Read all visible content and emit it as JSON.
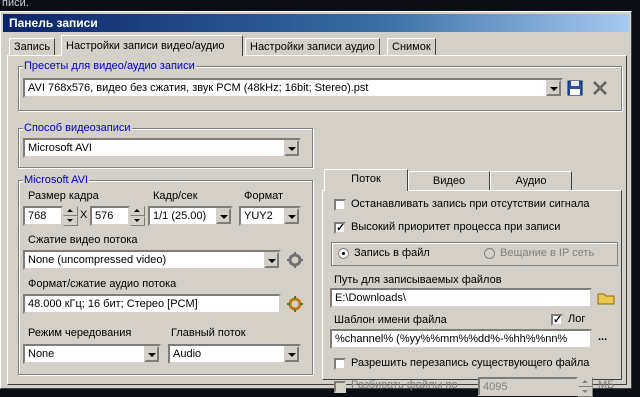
{
  "background_text": "писи.",
  "window": {
    "title": "Панель записи"
  },
  "tabs": [
    {
      "label": "Запись"
    },
    {
      "label": "Настройки записи видео/аудио"
    },
    {
      "label": "Настройки записи аудио"
    },
    {
      "label": "Снимок"
    }
  ],
  "presets": {
    "title": "Пресеты для видео/аудио записи",
    "value": "AVI 768x576, видео без сжатия, звук PCM (48kHz; 16bit; Stereo).pst"
  },
  "video_method": {
    "title": "Способ видеозаписи",
    "value": "Microsoft AVI"
  },
  "msavi": {
    "title": "Microsoft AVI",
    "frame_size_label": "Размер кадра",
    "width": "768",
    "x_label": "X",
    "height": "576",
    "fps_label": "Кадр/сек",
    "fps_value": "1/1 (25.00)",
    "format_label": "Формат",
    "format_value": "YUY2",
    "compression_label": "Сжатие видео потока",
    "compression_value": "None (uncompressed video)",
    "audio_label": "Формат/сжатие аудио потока",
    "audio_value": "48.000 кГц; 16 бит; Стерео [PCM]",
    "interleave_label": "Режим чередования",
    "interleave_value": "None",
    "master_label": "Главный поток",
    "master_value": "Audio"
  },
  "right_tabs": [
    {
      "label": "Поток"
    },
    {
      "label": "Видео"
    },
    {
      "label": "Аудио"
    }
  ],
  "stream": {
    "stop_no_signal": "Останавливать запись при отсутствии сигнала",
    "high_priority": "Высокий приоритет процесса при записи",
    "record_to_file": "Запись в файл",
    "ip_broadcast": "Вещание в IP сеть",
    "path_label": "Путь для записываемых файлов",
    "path_value": "E:\\Downloads\\",
    "template_label": "Шаблон имени файла",
    "log_label": "Лог",
    "template_value": "%channel% (%yy%%mm%%dd%-%hh%%nn%",
    "browse_ellipsis": "...",
    "allow_overwrite": "Разрешить перезапись существующего файла",
    "split_label": "Разбивать файлы по",
    "split_value": "4095",
    "split_unit": "МБ"
  },
  "colors": {
    "title_start": "#0a246a",
    "title_end": "#a6caf0",
    "group_title": "#0000c8",
    "face": "#d4d0c8"
  },
  "icons": [
    "save-icon",
    "delete-icon",
    "settings-icon",
    "audio-settings-icon",
    "folder-icon"
  ]
}
